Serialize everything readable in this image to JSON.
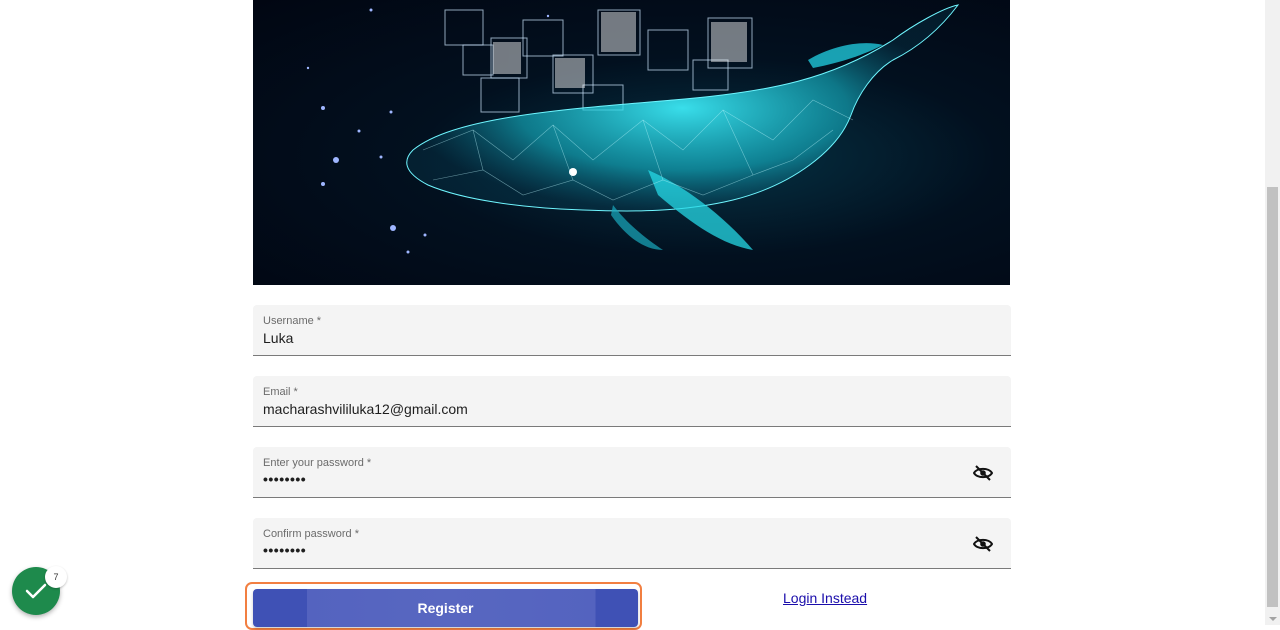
{
  "hero": {
    "icon": "glowing-whale-illustration"
  },
  "form": {
    "username": {
      "label": "Username *",
      "value": "Luka"
    },
    "email": {
      "label": "Email *",
      "value": "macharashvililuka12@gmail.com"
    },
    "password": {
      "label": "Enter your password *",
      "value": "••••••••",
      "toggle_icon": "eye-off-icon"
    },
    "confirm_password": {
      "label": "Confirm password *",
      "value": "••••••••",
      "toggle_icon": "eye-off-icon"
    }
  },
  "actions": {
    "register_label": "Register",
    "login_label": "Login Instead"
  },
  "fab": {
    "icon": "check-icon",
    "badge_count": "7",
    "color": "#1e8a4c"
  },
  "colors": {
    "primary": "#3f51b5",
    "focus_outline": "#f27f41",
    "link": "#1a0dab"
  }
}
